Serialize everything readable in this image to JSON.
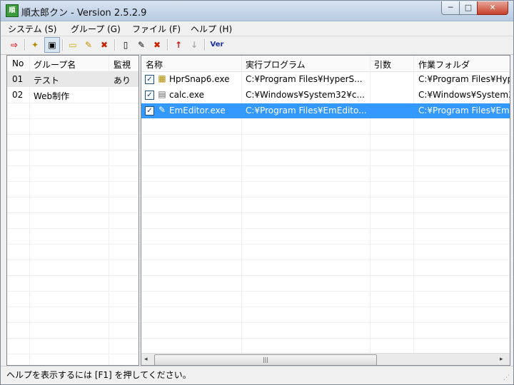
{
  "window": {
    "title": "順太郎クン - Version 2.5.2.9",
    "app_icon": "app-leaf-icon"
  },
  "window_controls": {
    "minimize": "─",
    "maximize": "□",
    "close": "✕"
  },
  "menu": [
    "システム (S)",
    "グループ (G)",
    "ファイル (F)",
    "ヘルプ (H)"
  ],
  "toolbar": {
    "exit": "⇨",
    "new_group": "✦",
    "edit_group": "▣",
    "folder": "▭",
    "folder_edit": "✎",
    "folder_delete": "✖",
    "new_file": "▯",
    "file_edit": "✎",
    "file_delete": "✖",
    "move_up": "↑",
    "move_down": "↓",
    "version": "Ver"
  },
  "groups": {
    "headers": [
      "No",
      "グループ名",
      "監視"
    ],
    "rows": [
      {
        "no": "01",
        "name": "テスト",
        "watch": "あり"
      },
      {
        "no": "02",
        "name": "Web制作",
        "watch": ""
      }
    ]
  },
  "files": {
    "headers": [
      "名称",
      "実行プログラム",
      "引数",
      "作業フォルダ"
    ],
    "rows": [
      {
        "checked": "✓",
        "icon": "▦",
        "name": "HprSnap6.exe",
        "program": "C:¥Program Files¥HyperS...",
        "args": "",
        "folder": "C:¥Program Files¥Hyp"
      },
      {
        "checked": "✓",
        "icon": "▤",
        "name": "calc.exe",
        "program": "C:¥Windows¥System32¥c...",
        "args": "",
        "folder": "C:¥Windows¥System3"
      },
      {
        "checked": "✓",
        "icon": "✎",
        "name": "EmEditor.exe",
        "program": "C:¥Program Files¥EmEdito...",
        "args": "",
        "folder": "C:¥Program Files¥Em"
      }
    ]
  },
  "scrollbar": {
    "left": "◂",
    "right": "▸",
    "grip": "|||"
  },
  "status": {
    "text": "ヘルプを表示するには [F1] を押してください。",
    "grip": "⋰"
  },
  "colors": {
    "selection": "#3399ff",
    "title_bar": "#c6d5e8",
    "close_button": "#c7402a"
  }
}
